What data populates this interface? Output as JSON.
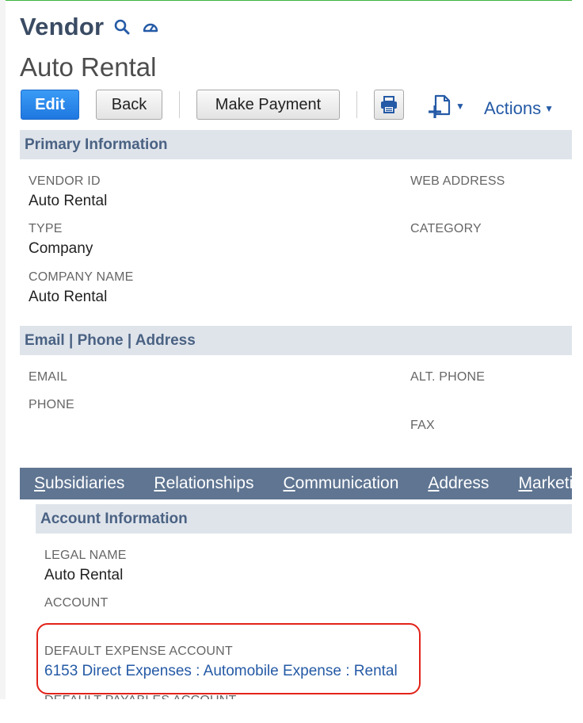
{
  "header": {
    "page_type": "Vendor",
    "record_name": "Auto Rental"
  },
  "toolbar": {
    "edit": "Edit",
    "back": "Back",
    "make_payment": "Make Payment",
    "actions": "Actions"
  },
  "primary": {
    "title": "Primary Information",
    "vendor_id_label": "VENDOR ID",
    "vendor_id_value": "Auto Rental",
    "web_address_label": "WEB ADDRESS",
    "type_label": "TYPE",
    "type_value": "Company",
    "category_label": "CATEGORY",
    "company_name_label": "COMPANY NAME",
    "company_name_value": "Auto Rental"
  },
  "contact": {
    "title": "Email | Phone | Address",
    "email_label": "EMAIL",
    "alt_phone_label": "ALT. PHONE",
    "phone_label": "PHONE",
    "fax_label": "FAX"
  },
  "subtabs": [
    {
      "first": "S",
      "rest": "ubsidiaries"
    },
    {
      "first": "R",
      "rest": "elationships"
    },
    {
      "first": "C",
      "rest": "ommunication"
    },
    {
      "first": "A",
      "rest": "ddress"
    },
    {
      "first": "M",
      "rest": "arketing"
    }
  ],
  "account": {
    "title": "Account Information",
    "legal_name_label": "LEGAL NAME",
    "legal_name_value": "Auto Rental",
    "account_label": "ACCOUNT",
    "default_expense_label": "DEFAULT EXPENSE ACCOUNT",
    "default_expense_value": "6153 Direct Expenses : Automobile Expense : Rental",
    "default_payables_label": "DEFAULT PAYABLES ACCOUNT"
  },
  "colors": {
    "accent_blue": "#1f78e0",
    "link_blue": "#255aa6",
    "subtab_bar": "#5f7592",
    "highlight_red": "#e2231a"
  }
}
